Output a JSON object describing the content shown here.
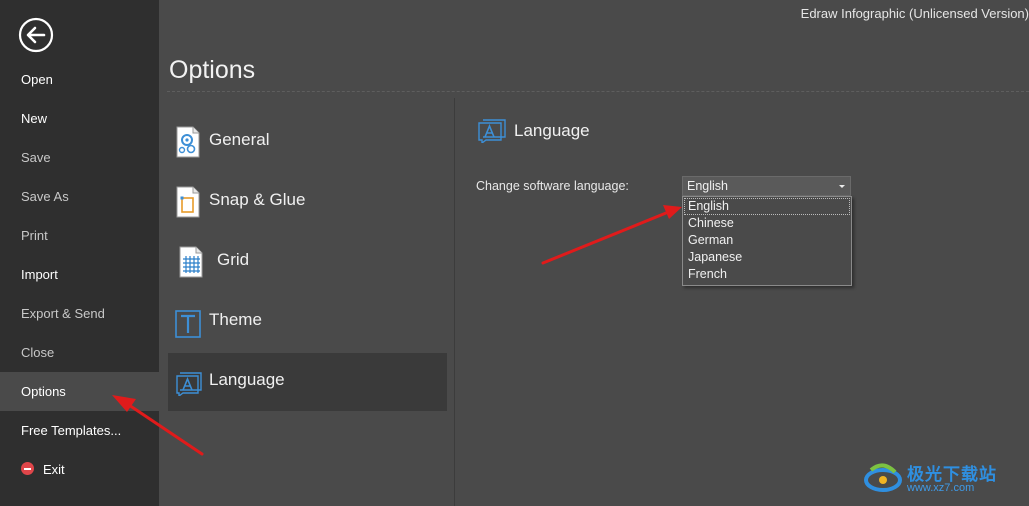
{
  "app_title": "Edraw Infographic (Unlicensed Version)",
  "page_title": "Options",
  "sidebar": {
    "items": [
      {
        "label": "Open"
      },
      {
        "label": "New"
      },
      {
        "label": "Save"
      },
      {
        "label": "Save As"
      },
      {
        "label": "Print"
      },
      {
        "label": "Import"
      },
      {
        "label": "Export & Send"
      },
      {
        "label": "Close"
      },
      {
        "label": "Options"
      },
      {
        "label": "Free Templates..."
      },
      {
        "label": "Exit"
      }
    ]
  },
  "categories": [
    {
      "label": "General"
    },
    {
      "label": "Snap & Glue"
    },
    {
      "label": "Grid"
    },
    {
      "label": "Theme"
    },
    {
      "label": "Language"
    }
  ],
  "language_section": {
    "title": "Language",
    "field_label": "Change software language:",
    "selected_value": "English",
    "options": [
      "English",
      "Chinese",
      "German",
      "Japanese",
      "French"
    ]
  },
  "colors": {
    "sidebar_bg": "#2f2f2f",
    "main_bg": "#4a4a4a",
    "accent_icon": "#3d8fd6",
    "annotation_arrow": "#e01b1b"
  },
  "watermark": {
    "text": "极光下载站",
    "url": "www.xz7.com"
  }
}
